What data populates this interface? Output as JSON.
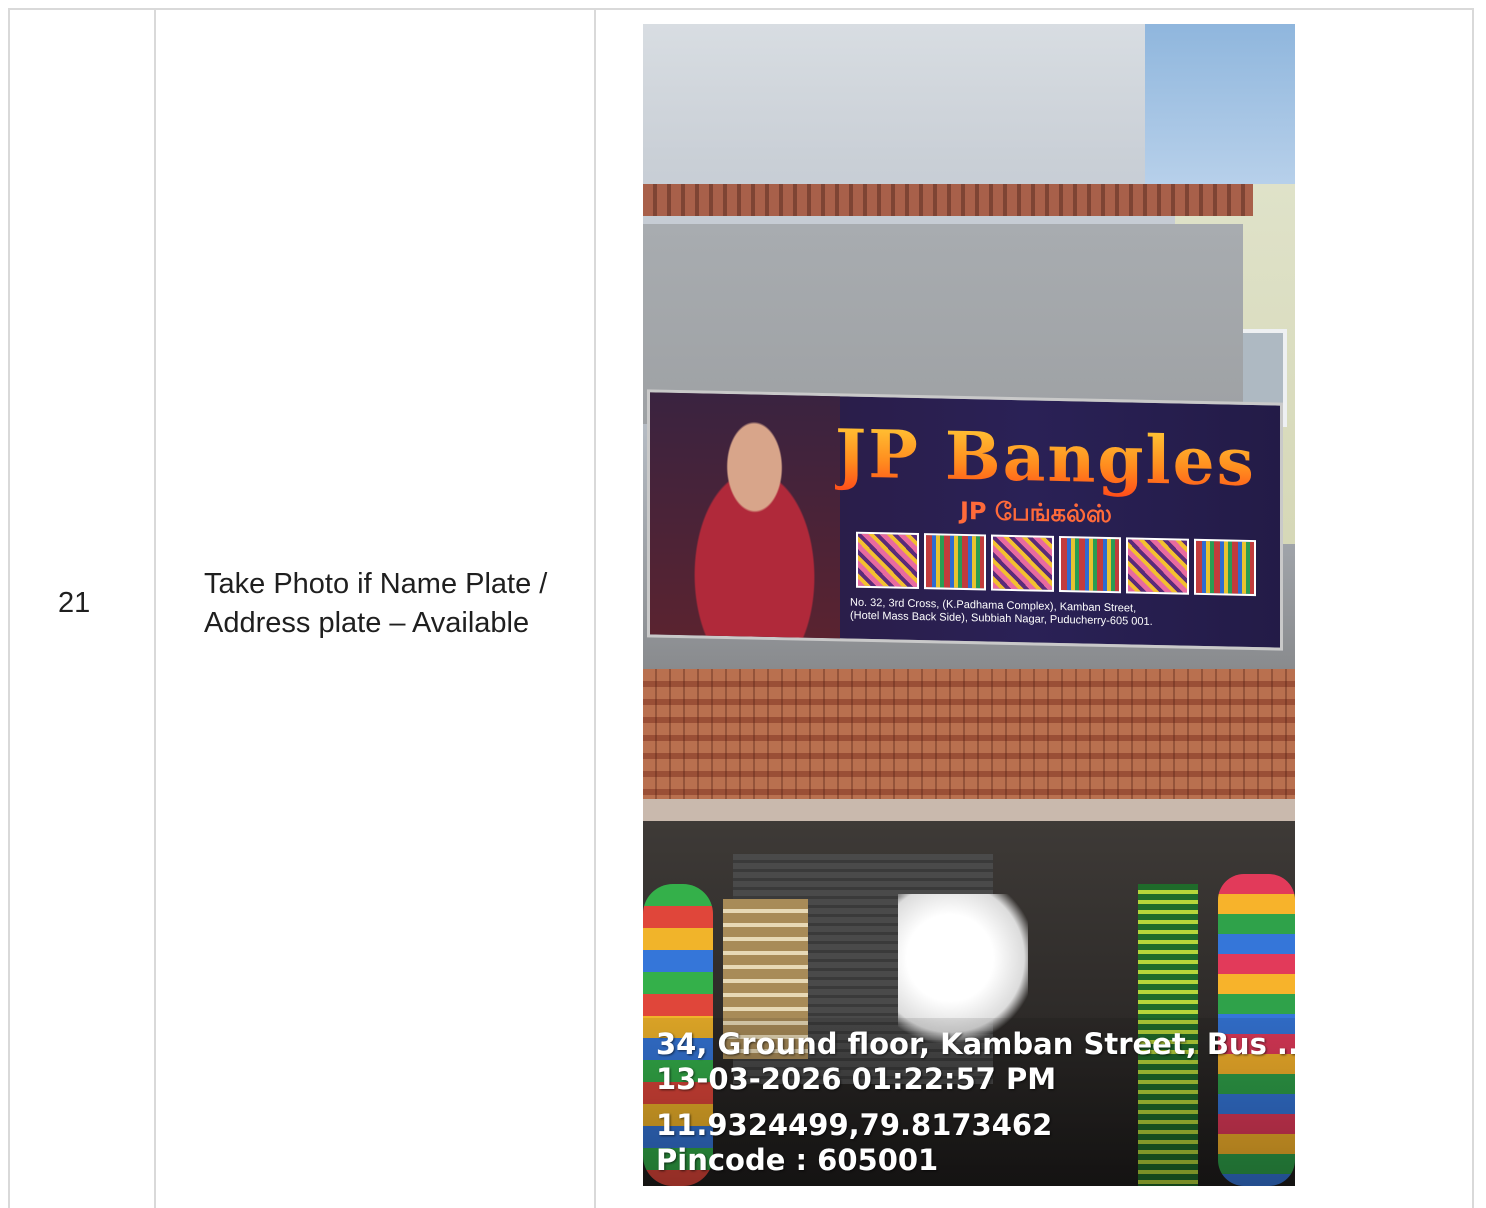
{
  "row": {
    "number": "21",
    "label": "Take Photo if Name Plate / Address plate – Available"
  },
  "photo": {
    "sign_title": "JP Bangles",
    "sign_subtitle": "JP பேங்கல்ஸ்",
    "sign_address_line1": "No. 32, 3rd Cross, (K.Padhama Complex), Kamban Street,",
    "sign_address_line2": "(Hotel Mass Back Side), Subbiah Nagar, Puducherry-605 001.",
    "stamp_address": "34, Ground floor, Kamban Street, Bus ...",
    "stamp_datetime": "13-03-2026 01:22:57 PM",
    "stamp_coordinates": "11.9324499,79.8173462",
    "stamp_pincode": "Pincode : 605001"
  }
}
